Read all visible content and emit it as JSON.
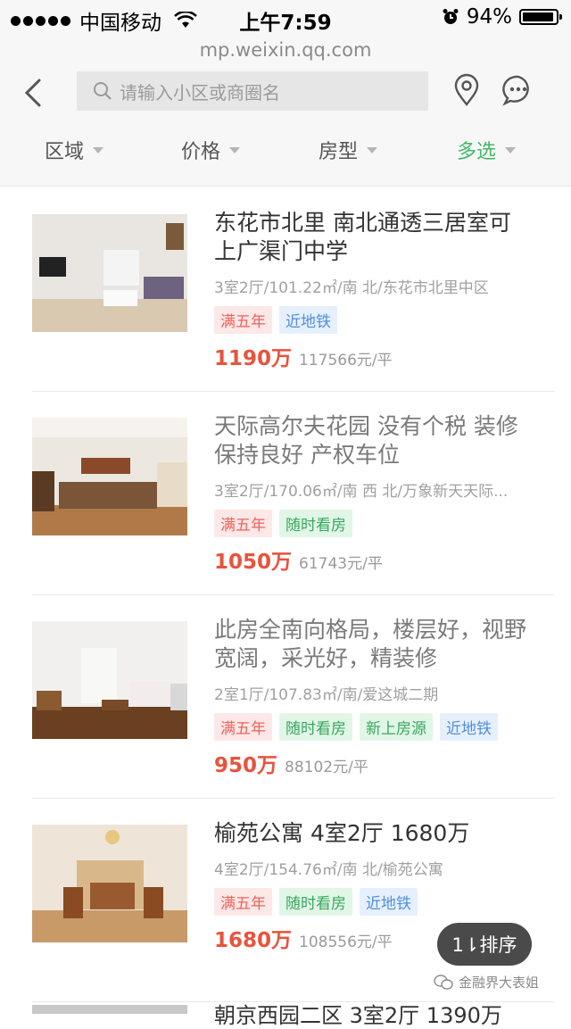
{
  "status_bar": {
    "carrier": "中国移动",
    "time": "上午7:59",
    "battery": "94%",
    "battery_level": 0.94
  },
  "url": "mp.weixin.qq.com",
  "search": {
    "placeholder": "请输入小区或商圈名"
  },
  "filters": [
    {
      "label": "区域"
    },
    {
      "label": "价格"
    },
    {
      "label": "房型"
    },
    {
      "label": "多选"
    }
  ],
  "listings": [
    {
      "title": "东花市北里 南北通透三居室可上广渠门中学",
      "meta": "3室2厅/101.22㎡/南 北/东花市北里中区",
      "tags": [
        "满五年",
        "近地铁"
      ],
      "price": "1190万",
      "unit_price": "117566元/平"
    },
    {
      "title": "天际高尔夫花园 没有个税 装修保持良好 产权车位",
      "meta": "3室2厅/170.06㎡/南 西 北/万象新天天际...",
      "tags": [
        "满五年",
        "随时看房"
      ],
      "price": "1050万",
      "unit_price": "61743元/平"
    },
    {
      "title": "此房全南向格局，楼层好，视野宽阔，采光好，精装修",
      "meta": "2室1厅/107.83㎡/南/爱这城二期",
      "tags": [
        "满五年",
        "随时看房",
        "新上房源",
        "近地铁"
      ],
      "price": "950万",
      "unit_price": "88102元/平"
    },
    {
      "title": "榆苑公寓 4室2厅 1680万",
      "meta": "4室2厅/154.76㎡/南 北/榆苑公寓",
      "tags": [
        "满五年",
        "随时看房",
        "近地铁"
      ],
      "price": "1680万",
      "unit_price": "108556元/平"
    }
  ],
  "next_listing_partial": "朝京西园二区 3室2厅 1390万",
  "sort_button": "1⇂排序",
  "watermark": "金融界大表姐",
  "colors": {
    "accent_green": "#41b86a",
    "price_red": "#e8533d"
  }
}
